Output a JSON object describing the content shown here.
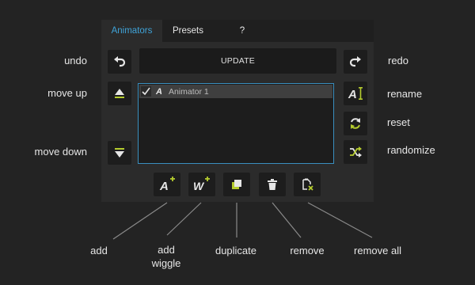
{
  "tabs": [
    {
      "label": "Animators",
      "active": true
    },
    {
      "label": "Presets",
      "active": false
    },
    {
      "label": "?",
      "active": false
    }
  ],
  "update_label": "UPDATE",
  "animator_list": {
    "items": [
      {
        "checked": true,
        "type_glyph": "A",
        "name": "Animator 1"
      }
    ]
  },
  "callouts": {
    "undo": "undo",
    "move_up": "move up",
    "move_down": "move down",
    "redo": "redo",
    "rename": "rename",
    "reset": "reset",
    "randomize": "randomize",
    "add": "add",
    "add_wiggle_line1": "add",
    "add_wiggle_line2": "wiggle",
    "duplicate": "duplicate",
    "remove": "remove",
    "remove_all": "remove all"
  },
  "icons": {
    "undo": "undo-icon",
    "redo": "redo-icon",
    "move_up": "move-up-icon",
    "move_down": "move-down-icon",
    "rename": "rename-icon",
    "reset": "reset-icon",
    "randomize": "randomize-icon",
    "add": "add-animator-icon",
    "add_wiggle": "add-wiggle-icon",
    "duplicate": "duplicate-icon",
    "remove": "trash-icon",
    "remove_all": "remove-all-icon"
  },
  "colors": {
    "background": "#232323",
    "panel": "#2b2b2b",
    "accent_blue": "#3fa3d8",
    "accent_green": "#b5cc2e",
    "icon_light": "#e6e6e6"
  }
}
